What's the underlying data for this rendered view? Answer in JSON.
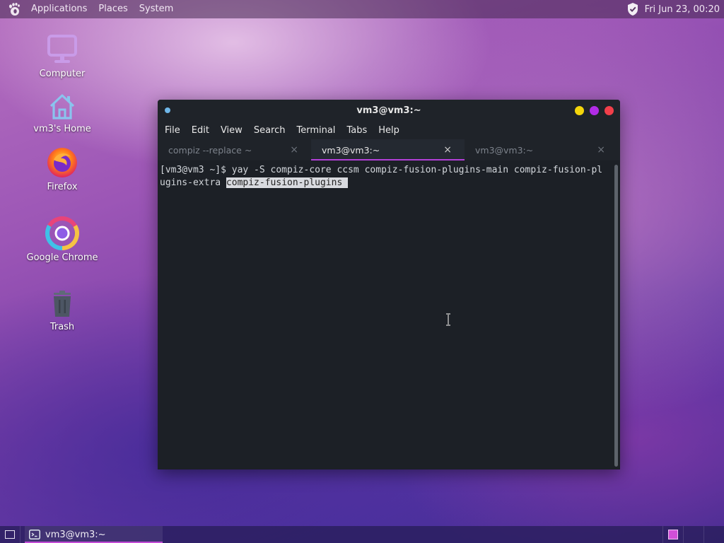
{
  "top_panel": {
    "menus": [
      "Applications",
      "Places",
      "System"
    ],
    "clock": "Fri Jun 23, 00:20",
    "icons": {
      "distro": "gnome-foot-icon",
      "security": "shield-icon"
    }
  },
  "desktop_icons": [
    {
      "label": "Computer",
      "icon": "computer-icon"
    },
    {
      "label": "vm3's Home",
      "icon": "home-icon"
    },
    {
      "label": "Firefox",
      "icon": "firefox-icon"
    },
    {
      "label": "Google Chrome",
      "icon": "chrome-icon"
    },
    {
      "label": "Trash",
      "icon": "trash-icon"
    }
  ],
  "terminal": {
    "title": "vm3@vm3:~",
    "menu": [
      "File",
      "Edit",
      "View",
      "Search",
      "Terminal",
      "Tabs",
      "Help"
    ],
    "tabs": [
      {
        "label": "compiz --replace ~",
        "active": false
      },
      {
        "label": "vm3@vm3:~",
        "active": true
      },
      {
        "label": "vm3@vm3:~",
        "active": false
      }
    ],
    "tab_close_glyph": "×",
    "lines": {
      "line1": "[vm3@vm3 ~]$ yay -S compiz-core ccsm compiz-fusion-plugins-main compiz-fusion-pl",
      "line2_prefix": "ugins-extra ",
      "line2_selected": "compiz-fusion-plugins "
    },
    "colors": {
      "accent": "#b33fd8",
      "minimize": "#f4d50b",
      "maximize": "#b12ce6",
      "close": "#f23f4a"
    }
  },
  "bottom_panel": {
    "task_label": "vm3@vm3:~",
    "workspaces": [
      true,
      false,
      false
    ]
  }
}
